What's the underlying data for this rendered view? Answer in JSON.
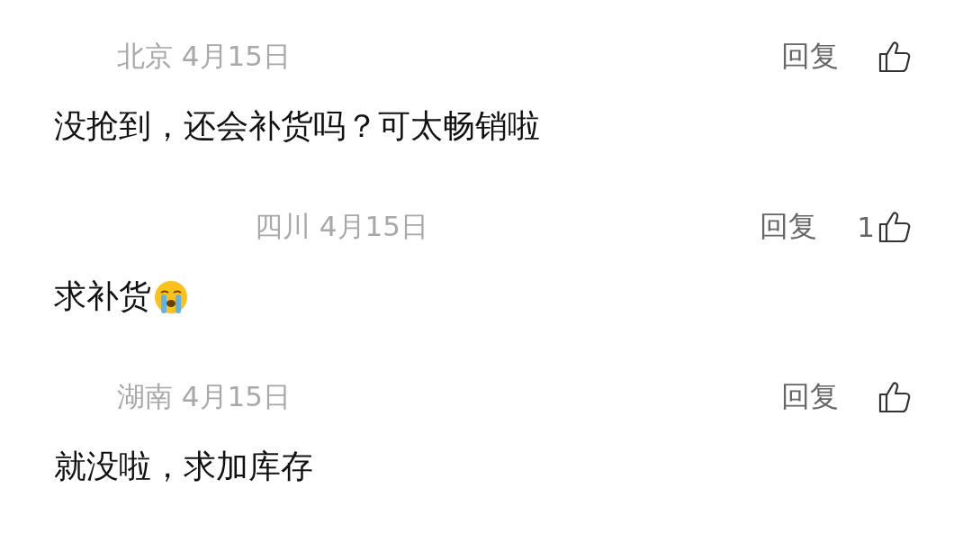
{
  "comments": [
    {
      "location": "北京",
      "date": "4月15日",
      "reply": "回复",
      "text": "没抢到，还会补货吗？可太畅销啦"
    },
    {
      "location": "四川",
      "date": "4月15日",
      "reply": "回复",
      "likes": "1",
      "text": "求补货",
      "emoji": true
    },
    {
      "location": "湖南",
      "date": "4月15日",
      "reply": "回复",
      "text": "就没啦，求加库存"
    }
  ]
}
